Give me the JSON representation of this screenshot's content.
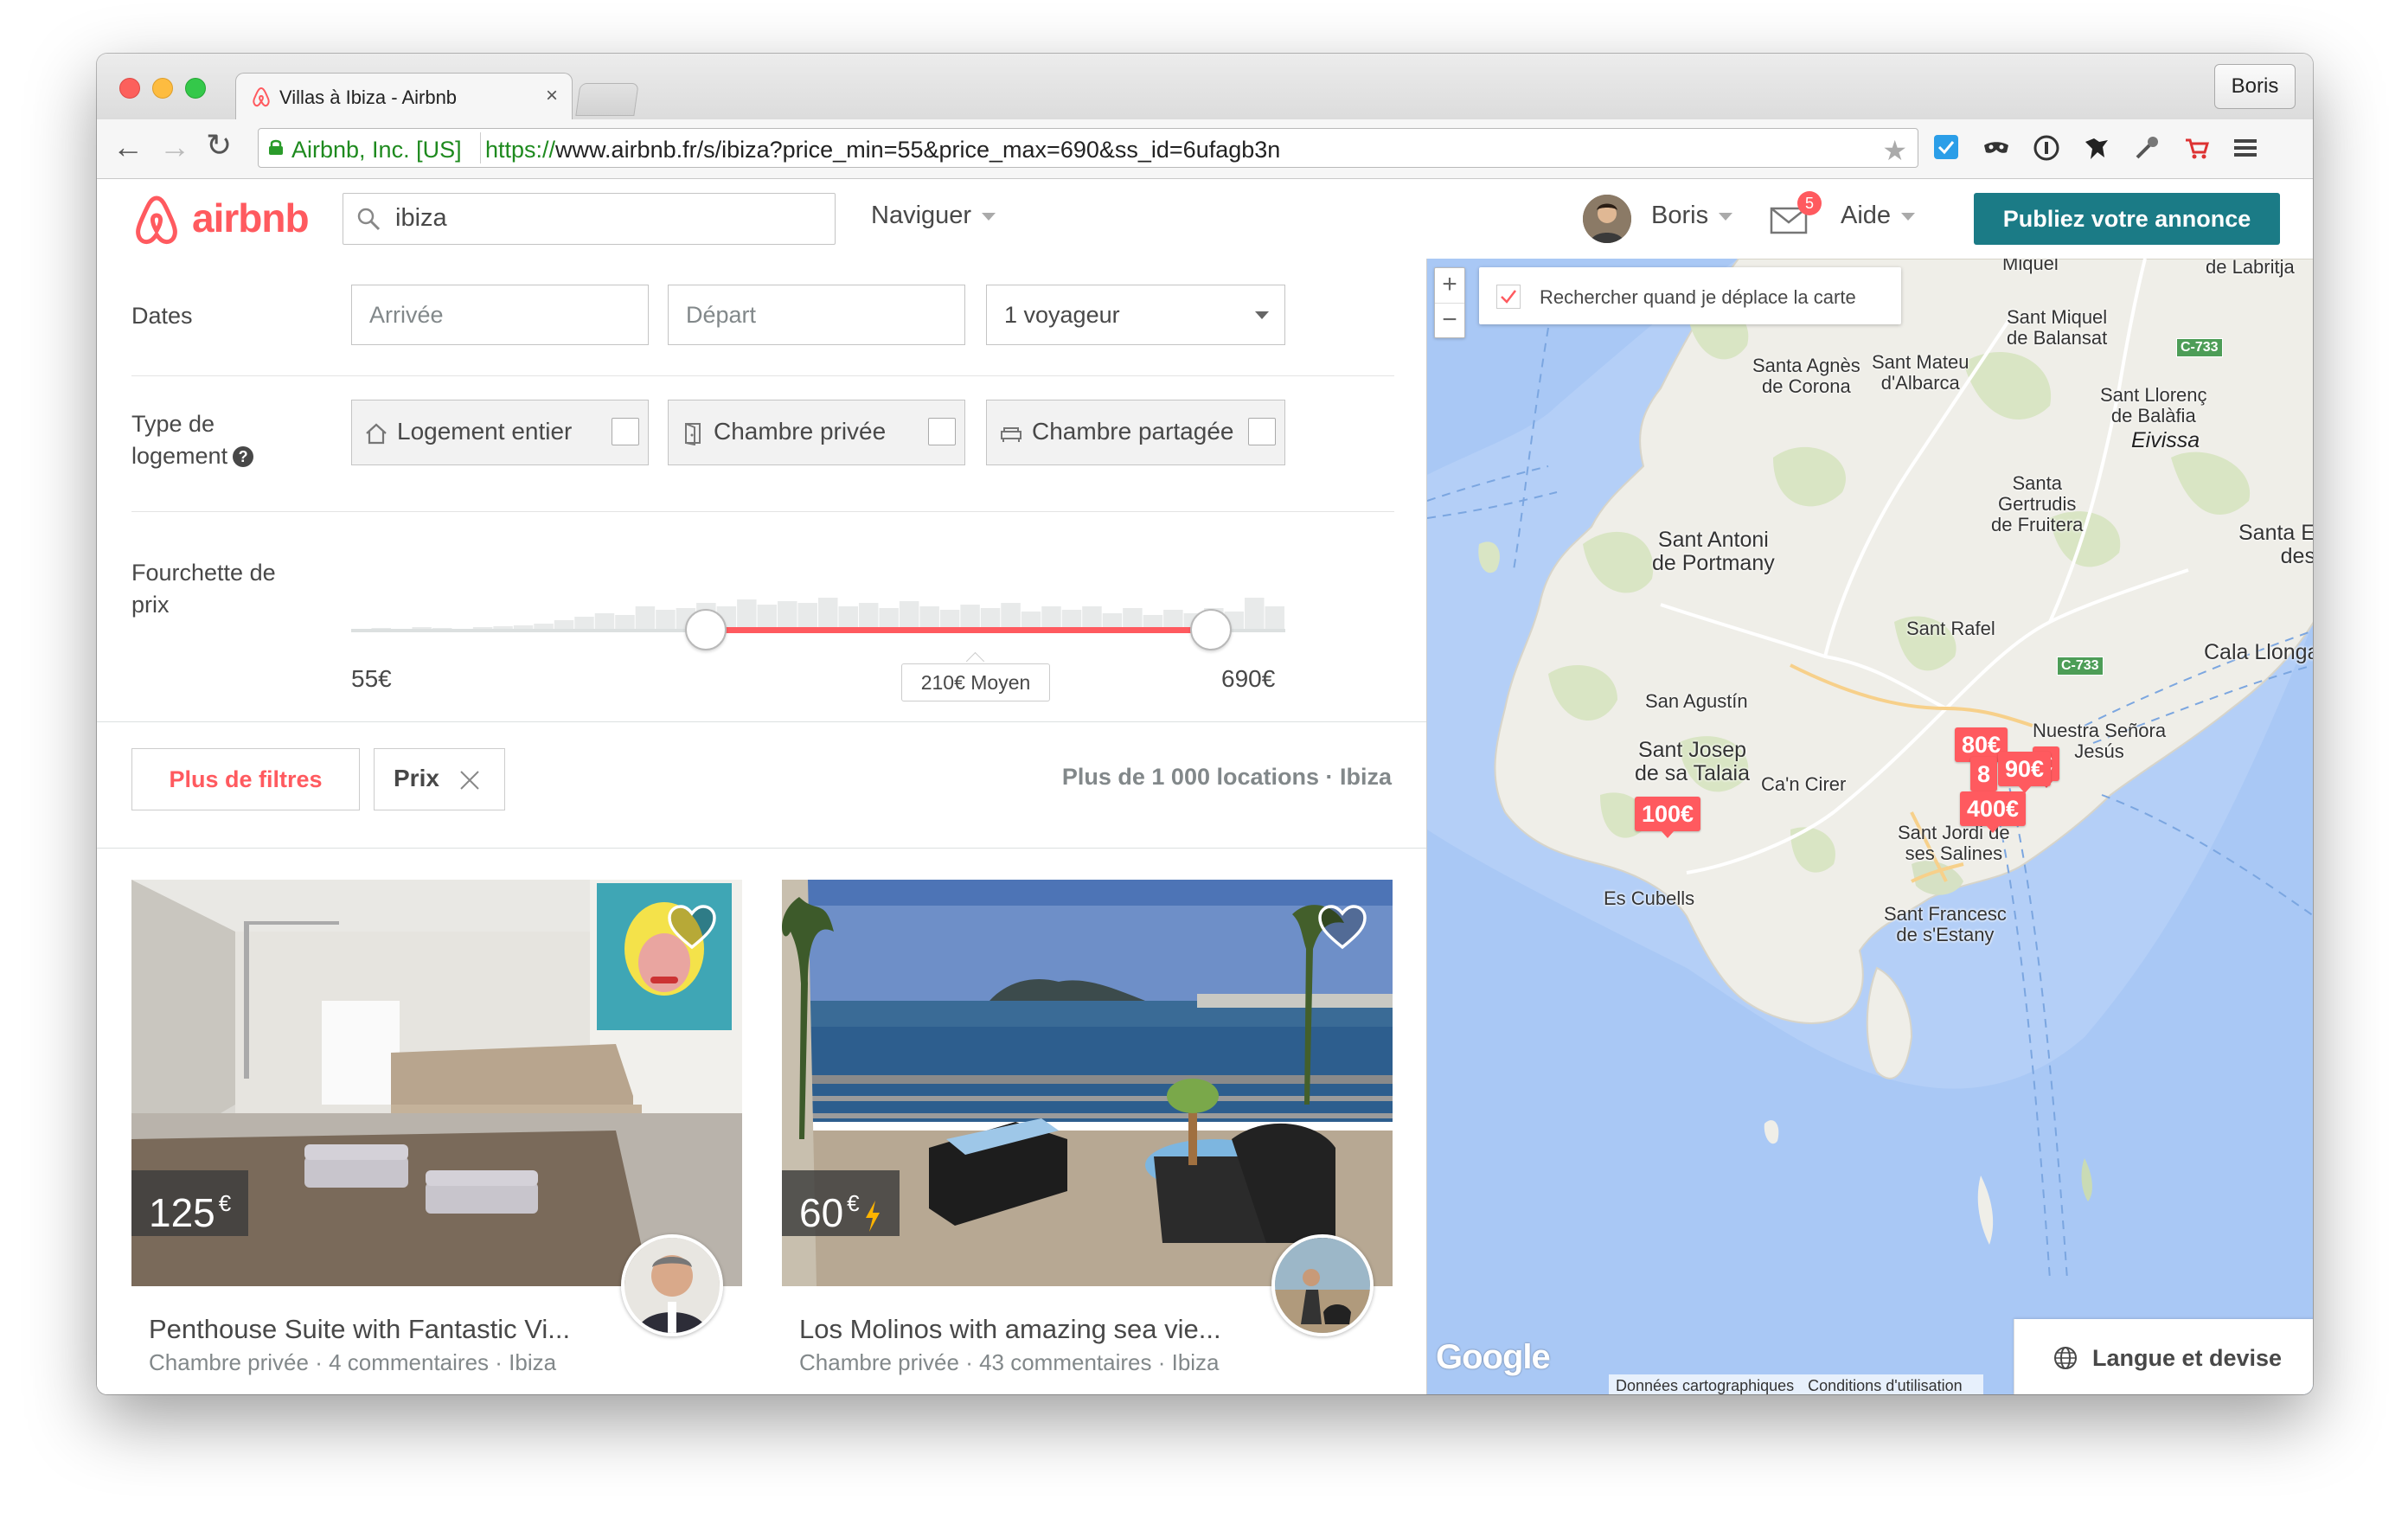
{
  "browser": {
    "tab_title": "Villas à Ibiza - Airbnb",
    "tab_close": "×",
    "profile_name": "Boris",
    "ev_name": "Airbnb, Inc. [US]",
    "url_scheme": "https://",
    "url_rest": "www.airbnb.fr/s/ibiza?price_min=55&price_max=690&ss_id=6ufagb3n",
    "extensions": [
      "checkmark-extension-icon",
      "mask-extension-icon",
      "info-circle-extension-icon",
      "ninja-extension-icon",
      "eyedropper-extension-icon",
      "cart-extension-icon",
      "menu-icon"
    ]
  },
  "header": {
    "brand": "airbnb",
    "search_value": "ibiza",
    "browse": "Naviguer",
    "user": "Boris",
    "messages_count": "5",
    "help": "Aide",
    "host_button": "Publiez votre annonce"
  },
  "filters": {
    "dates_label": "Dates",
    "checkin_placeholder": "Arrivée",
    "checkout_placeholder": "Départ",
    "guests": "1 voyageur",
    "room_type_label_1": "Type de",
    "room_type_label_2": "logement",
    "room_types": [
      {
        "label": "Logement entier",
        "icon": "house-icon",
        "checked": false
      },
      {
        "label": "Chambre privée",
        "icon": "door-icon",
        "checked": false
      },
      {
        "label": "Chambre partagée",
        "icon": "couch-icon",
        "checked": false
      }
    ],
    "price_label_1": "Fourchette de",
    "price_label_2": "prix",
    "price_min": "55€",
    "price_max": "690€",
    "price_avg": "210€ Moyen",
    "price_range_fraction": [
      0.38,
      0.92
    ],
    "more_filters": "Plus de filtres",
    "price_chip": "Prix",
    "results": "Plus de 1 000 locations · Ibiza"
  },
  "listings": [
    {
      "price": "125",
      "currency": "€",
      "instant": false,
      "title": "Penthouse Suite with Fantastic Vi...",
      "meta": "Chambre privée · 4 commentaires · Ibiza"
    },
    {
      "price": "60",
      "currency": "€",
      "instant": true,
      "title": "Los Molinos with amazing sea vie...",
      "meta": "Chambre privée · 43 commentaires · Ibiza"
    }
  ],
  "map": {
    "zoom_in": "+",
    "zoom_out": "−",
    "search_on_move": "Rechercher quand je déplace la carte",
    "search_on_move_checked": true,
    "places": {
      "p1": "Miquel",
      "p2": "de Labritja",
      "p3a": "Sant Miquel",
      "p3b": "de Balansat",
      "p4a": "Santa Agnès",
      "p4b": "de Corona",
      "p5a": "Sant Mateu",
      "p5b": "d'Albarca",
      "p6a": "Sant Llorenç",
      "p6b": "de Balàfia",
      "p7": "Eivissa",
      "p8a": "Santa",
      "p8b": "Gertrudis",
      "p8c": "de Fruitera",
      "p9a": "Sant Antoni",
      "p9b": "de Portmany",
      "p10a": "Santa E",
      "p10b": "des",
      "p11": "Sant Rafel",
      "p12": "Cala Llonga",
      "p13": "San Agustín",
      "p14a": "Nuestra Señora",
      "p14b": "Jesús",
      "p15a": "Sant Josep",
      "p15b": "de sa Talaia",
      "p16": "Ca'n Cirer",
      "p17a": "Sant Jordi de",
      "p17b": "ses Salines",
      "p18": "Es Cubells",
      "p19a": "Sant Francesc",
      "p19b": "de s'Estany"
    },
    "roads": [
      "C-733",
      "C-733"
    ],
    "markers": [
      "80€",
      "90€",
      "€",
      "400€",
      "100€",
      "8"
    ],
    "google": "Google",
    "attribution_data": "Données cartographiques",
    "attribution_terms": "Conditions d'utilisation",
    "language_currency": "Langue et devise"
  },
  "colors": {
    "brand": "#ff5a5f",
    "host_button": "#1b7b86",
    "sea": "#a9c8f5",
    "land": "#efeee8"
  }
}
